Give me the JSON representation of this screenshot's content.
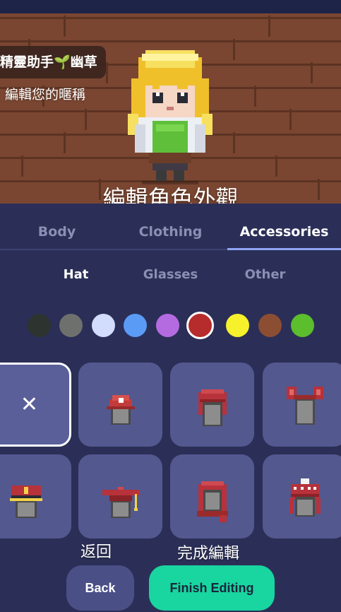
{
  "header": {
    "character_name": "精靈助手🌱幽草",
    "edit_nickname": "編輯您的暱稱",
    "edit_appearance": "編輯角色外觀"
  },
  "tabs": [
    {
      "label": "Body",
      "active": false
    },
    {
      "label": "Clothing",
      "active": false
    },
    {
      "label": "Accessories",
      "active": true
    }
  ],
  "subtabs": [
    {
      "label": "Hat",
      "active": true
    },
    {
      "label": "Glasses",
      "active": false
    },
    {
      "label": "Other",
      "active": false
    }
  ],
  "colors": [
    "#2d332f",
    "#6e706e",
    "#d2dcfc",
    "#5a9bf6",
    "#b56be0",
    "#b62b2b",
    "#f7f12c",
    "#8c4e33",
    "#5cbd2d"
  ],
  "selected_color": "#b62b2b",
  "items": [
    {
      "name": "none",
      "symbol": "✕",
      "selected": true
    },
    {
      "name": "red-cap-icon"
    },
    {
      "name": "red-hood-icon"
    },
    {
      "name": "red-bow-icon"
    },
    {
      "name": "captain-hat-icon"
    },
    {
      "name": "graduation-cap-icon"
    },
    {
      "name": "red-scarf-hood-icon"
    },
    {
      "name": "knit-beanie-icon"
    }
  ],
  "bottom": {
    "back_caption": "返回",
    "finish_caption": "完成編輯",
    "back_label": "Back",
    "finish_label": "Finish Editing"
  }
}
